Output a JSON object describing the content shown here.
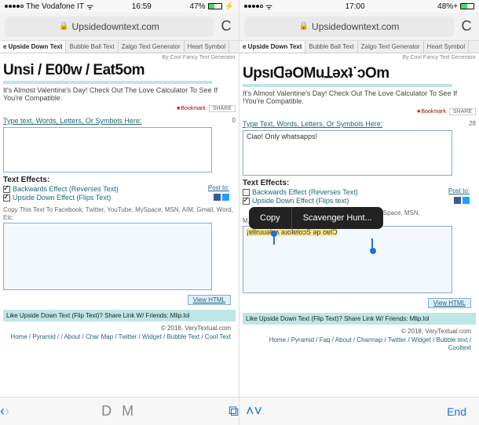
{
  "left": {
    "status": {
      "carrier": "The Vodafone IT",
      "wifi": true,
      "time": "16:59",
      "battery_pct": "47%",
      "charging": true
    },
    "url": "Upsidedowntext.com",
    "tabs": [
      "e Upside Down Text",
      "Bubble Ball Text",
      "Zalgo Text Generator",
      "Heart Symbol"
    ],
    "credit": "By Cool Fancy Text Generator",
    "title": "Unsi / E00w / Eat5om",
    "promo": "It's Almost Valentine's Day! Check Out The Love Calculator To See If You're Compatible.",
    "bookmark_label": "Bookmark",
    "share_label": "SHARE",
    "type_label": "Type text, Words, Letters, Or Symbols Here:",
    "char_count": "0",
    "input_value": "",
    "effects_label": "Text Effects:",
    "effect1": "Backwards Effect (Reverses Text)",
    "effect2": "Upside Down Effect (Flips Text)",
    "effect1_checked": true,
    "effect2_checked": true,
    "postto_label": "Post to:",
    "copy_hint": "Copy This Text To Facebook, Twitter, YouTube, MySpace, MSN, AIM, Gmail, Word, Etc:",
    "output_value": "",
    "view_html": "View HTML",
    "like_row": "Like Upside Down Text (Flip Text)? Share Link W/ Friends: Mlip.lol",
    "copyright": "© 2018, VeryTextual.com",
    "footer_links": "Home / Pyramid / / About / Char Map / Twitter / Widget / Bubble Text / Cool Text",
    "bottom_center": "D M"
  },
  "right": {
    "status": {
      "carrier": "",
      "wifi": true,
      "time": "17:00",
      "battery_pct": "48%+",
      "charging": false
    },
    "url": "Upsidedowntext.com",
    "tabs": [
      "e Upside Down Text",
      "Bubble Ball Text",
      "Zalgo Text Generator",
      "Heart Symbol"
    ],
    "credit": "By Cool Fancy Text Generator",
    "title": "UpsıᗡǝOMuꞱǝxʇ˙ɔOm",
    "promo": "It's Almost Valentine's Day! Check Out The Love Calculator To See If !You're Compatible.",
    "bookmark_label": "Bookmark",
    "share_label": "SHARE",
    "type_label": "Type Text, Words, Letters, Or Symbols Here:",
    "char_count": "28",
    "input_value": "Ciao! Only whatsapps!",
    "effects_label": "Text Effects:",
    "effect1": "Backwards Effect (Reverses Text)",
    "effect2": "Upside Down Effect (Flips text)",
    "effect1_checked": false,
    "effect2_checked": true,
    "postto_label": "Post to:",
    "ios_menu": {
      "copy": "Copy",
      "scavenger": "Scavenger Hunt..."
    },
    "copy_hint_tail": "ySpace, MSN,",
    "copy_hint_line2": "M, Gmail, xxx.d, etc:",
    "output_value": "¡ɐllnɹuǝlɐʌ ǝɹoʇɐloɔS ǝp oɐlƆ",
    "view_html": "View HTML",
    "like_row": "Like Upside Down Text (Flip Text)? Share Link W/ Friends: Mlip.lol",
    "copyright": "© 2018, VeryTextual.com",
    "footer_links": "Home / Pyramid / Faq / About / Charmap / Twitter / Widget / Bubble text / Cooltext",
    "bottom_arrows": "˄  ˅",
    "bottom_done": "End"
  }
}
